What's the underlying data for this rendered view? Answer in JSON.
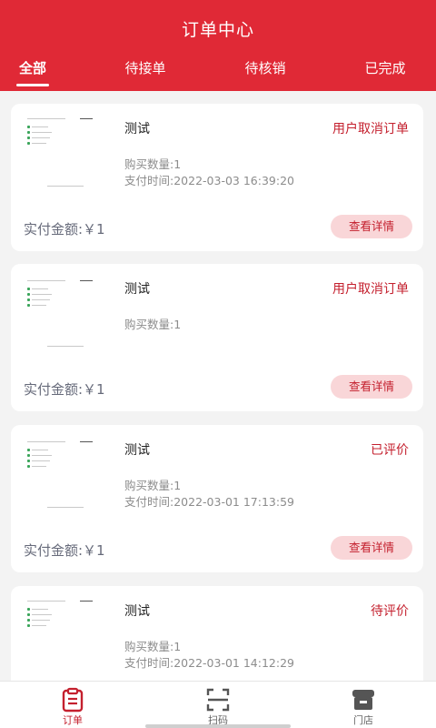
{
  "header": {
    "title": "订单中心",
    "tabs": [
      {
        "label": "全部"
      },
      {
        "label": "待接单"
      },
      {
        "label": "待核销"
      },
      {
        "label": "已完成"
      }
    ]
  },
  "orders": [
    {
      "name": "测试",
      "status": "用户取消订单",
      "qty": "购买数量:1",
      "pay_time": "支付时间:2022-03-03 16:39:20",
      "paid": "实付金额:￥1",
      "button": "查看详情"
    },
    {
      "name": "测试",
      "status": "用户取消订单",
      "qty": "购买数量:1",
      "pay_time": "",
      "paid": "实付金额:￥1",
      "button": "查看详情"
    },
    {
      "name": "测试",
      "status": "已评价",
      "qty": "购买数量:1",
      "pay_time": "支付时间:2022-03-01 17:13:59",
      "paid": "实付金额:￥1",
      "button": "查看详情"
    },
    {
      "name": "测试",
      "status": "待评价",
      "qty": "购买数量:1",
      "pay_time": "支付时间:2022-03-01 14:12:29",
      "paid": "",
      "button": ""
    }
  ],
  "bottom_nav": [
    {
      "label": "订单",
      "icon": "clipboard-icon"
    },
    {
      "label": "扫码",
      "icon": "scan-icon"
    },
    {
      "label": "门店",
      "icon": "store-icon"
    }
  ],
  "colors": {
    "brand": "#e02936",
    "accent_text": "#c4202e",
    "button_bg": "#f9d6d8"
  }
}
